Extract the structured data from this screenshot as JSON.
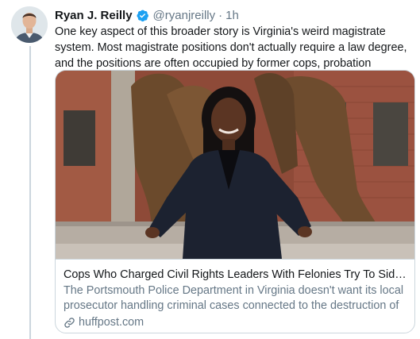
{
  "tweet": {
    "author_name": "Ryan J. Reilly",
    "handle": "@ryanjreilly",
    "separator": "·",
    "time": "1h",
    "text": "One key aspect of this broader story is Virginia's weird magistrate system. Most magistrate positions don't actually require a law degree, and the positions are often occupied by former cops, probation officers, etc.",
    "verified_icon": "verified-badge-icon",
    "colors": {
      "verified": "#1da1f2",
      "secondary_text": "#657786",
      "border": "#ccd6dd"
    }
  },
  "card": {
    "title": "Cops Who Charged Civil Rights Leaders With Felonies Try To Sideline Pr...",
    "description": "The Portsmouth Police Department in Virginia doesn't want its local prosecutor handling criminal cases connected to the destruction of ...",
    "domain": "huffpost.com",
    "domain_icon": "link-icon"
  }
}
